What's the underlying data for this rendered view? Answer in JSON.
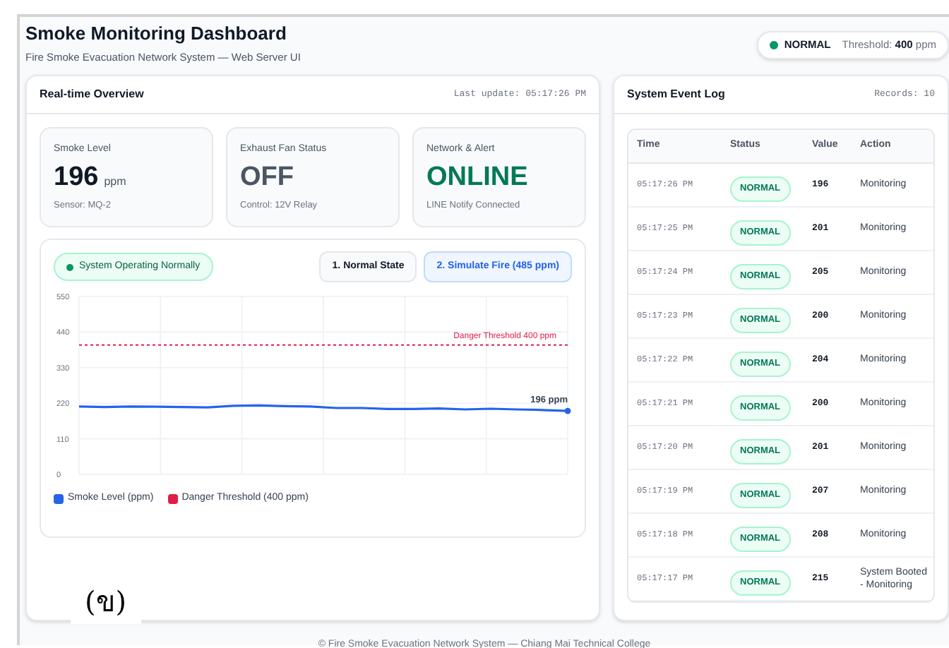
{
  "header": {
    "title": "Smoke Monitoring Dashboard",
    "subtitle": "Fire Smoke Evacuation Network System — Web Server UI",
    "status_pill": {
      "status": "NORMAL",
      "color": "#059669",
      "threshold_label": "Threshold:",
      "threshold_value": "400",
      "threshold_unit": "ppm"
    }
  },
  "overview": {
    "title": "Real-time Overview",
    "last_update": "Last update: 05:17:26 PM",
    "cards": [
      {
        "kind": "value",
        "label": "Smoke Level",
        "value": "196",
        "unit": "ppm",
        "note": "Sensor: MQ-2",
        "color": "#111827"
      },
      {
        "kind": "value",
        "label": "Exhaust Fan Status",
        "value": "OFF",
        "note": "Control: 12V Relay",
        "color": "#4b5563"
      },
      {
        "kind": "value",
        "label": "Network & Alert",
        "value": "ONLINE",
        "note": "LINE Notify Connected",
        "color": "#047857"
      }
    ],
    "system_status": {
      "text": "System Operating Normally",
      "color": "#059669"
    },
    "buttons": [
      {
        "label": "1. Normal State",
        "selected": false
      },
      {
        "label": "2. Simulate Fire (485 ppm)",
        "selected": true
      }
    ],
    "chart_data": {
      "type": "line",
      "grid": true,
      "yticks": [
        0,
        110,
        220,
        330,
        440,
        550
      ],
      "ylim": [
        0,
        550
      ],
      "series": [
        {
          "name": "Smoke Level (ppm)",
          "color": "#2563eb",
          "line_style": "solid",
          "values": [
            210,
            208,
            210,
            209,
            208,
            207,
            212,
            213,
            211,
            210,
            205,
            205,
            202,
            202,
            204,
            201,
            203,
            201,
            199,
            196
          ]
        },
        {
          "name": "Danger Threshold (400 ppm)",
          "color": "#e11d48",
          "line_style": "dashed",
          "values": [
            400,
            400,
            400,
            400,
            400,
            400,
            400,
            400,
            400,
            400,
            400,
            400,
            400,
            400,
            400,
            400,
            400,
            400,
            400,
            400
          ]
        }
      ],
      "annotations": [
        "Danger Threshold 400 ppm",
        "196 ppm"
      ]
    }
  },
  "event_log": {
    "title": "System Event Log",
    "records": "Records: 10",
    "columns": [
      "Time",
      "Status",
      "Value",
      "Action"
    ],
    "rows": [
      {
        "time": "05:17:26 PM",
        "status": "NORMAL",
        "value": "196",
        "action": "Monitoring"
      },
      {
        "time": "05:17:25 PM",
        "status": "NORMAL",
        "value": "201",
        "action": "Monitoring"
      },
      {
        "time": "05:17:24 PM",
        "status": "NORMAL",
        "value": "205",
        "action": "Monitoring"
      },
      {
        "time": "05:17:23 PM",
        "status": "NORMAL",
        "value": "200",
        "action": "Monitoring"
      },
      {
        "time": "05:17:22 PM",
        "status": "NORMAL",
        "value": "204",
        "action": "Monitoring"
      },
      {
        "time": "05:17:21 PM",
        "status": "NORMAL",
        "value": "200",
        "action": "Monitoring"
      },
      {
        "time": "05:17:20 PM",
        "status": "NORMAL",
        "value": "201",
        "action": "Monitoring"
      },
      {
        "time": "05:17:19 PM",
        "status": "NORMAL",
        "value": "207",
        "action": "Monitoring"
      },
      {
        "time": "05:17:18 PM",
        "status": "NORMAL",
        "value": "208",
        "action": "Monitoring"
      },
      {
        "time": "05:17:17 PM",
        "status": "NORMAL",
        "value": "215",
        "action": "System Booted - Monitoring"
      }
    ]
  },
  "figure_label": "(ข)",
  "footer": "© Fire Smoke Evacuation Network System — Chiang Mai Technical College"
}
